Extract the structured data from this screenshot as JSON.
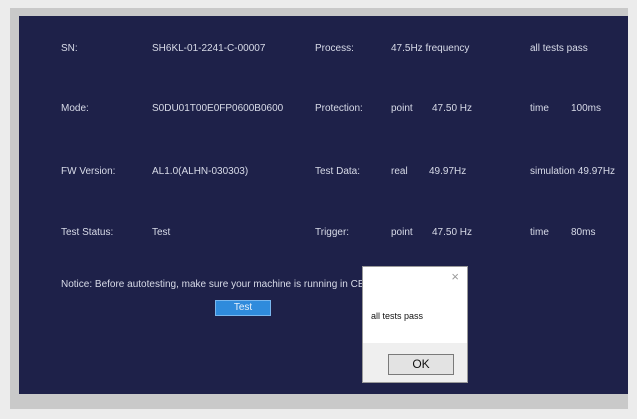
{
  "rows": [
    {
      "label": "SN:",
      "value": "SH6KL-01-2241-C-00007",
      "label2": "Process:",
      "col3": "47.5Hz frequency",
      "col4": "",
      "col5": "all tests pass",
      "col6": ""
    },
    {
      "label": "Mode:",
      "value": "S0DU01T00E0FP0600B0600",
      "label2": "Protection:",
      "col3": "point",
      "col4": "47.50 Hz",
      "col5": "time",
      "col6": "100ms"
    },
    {
      "label": "FW Version:",
      "value": "AL1.0(ALHN-030303)",
      "label2": "Test Data:",
      "col3": "real",
      "col4": "49.97Hz",
      "col5": "simulation 49.97Hz",
      "col6": ""
    },
    {
      "label": "Test Status:",
      "value": "Test",
      "label2": "Trigger:",
      "col3": "point",
      "col4": "47.50 Hz",
      "col5": "time",
      "col6": "80ms"
    }
  ],
  "notice": "Notice: Before autotesting, make sure your machine is running in CE",
  "notice_tail": "",
  "test_button": "Test",
  "dialog": {
    "close": "×",
    "message": "all tests pass",
    "ok": "OK"
  }
}
